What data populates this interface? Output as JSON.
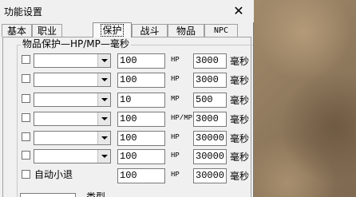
{
  "window": {
    "title": "功能设置",
    "close_glyph": "✕"
  },
  "tabs": [
    {
      "label": "基本",
      "active": false
    },
    {
      "label": "职业",
      "active": false
    },
    {
      "label": "保护",
      "active": true
    },
    {
      "label": "战斗",
      "active": false
    },
    {
      "label": "物品",
      "active": false
    },
    {
      "label": "NPC",
      "active": false
    }
  ],
  "group": {
    "title": "物品保护—HP/MP—毫秒"
  },
  "rows": [
    {
      "amount": "100",
      "type": "HP",
      "threshold": "3000",
      "unit": "毫秒"
    },
    {
      "amount": "100",
      "type": "HP",
      "threshold": "3000",
      "unit": "毫秒"
    },
    {
      "amount": "10",
      "type": "MP",
      "threshold": "500",
      "unit": "毫秒"
    },
    {
      "amount": "100",
      "type": "HP/MP",
      "threshold": "3000",
      "unit": "毫秒"
    },
    {
      "amount": "100",
      "type": "HP",
      "threshold": "30000",
      "unit": "毫秒"
    },
    {
      "amount": "100",
      "type": "HP",
      "threshold": "30000",
      "unit": "毫秒"
    }
  ],
  "auto_retreat": {
    "label": "自动小退",
    "amount": "100",
    "type": "HP",
    "threshold": "30000",
    "unit": "毫秒"
  },
  "bottom": {
    "label": "类型"
  }
}
